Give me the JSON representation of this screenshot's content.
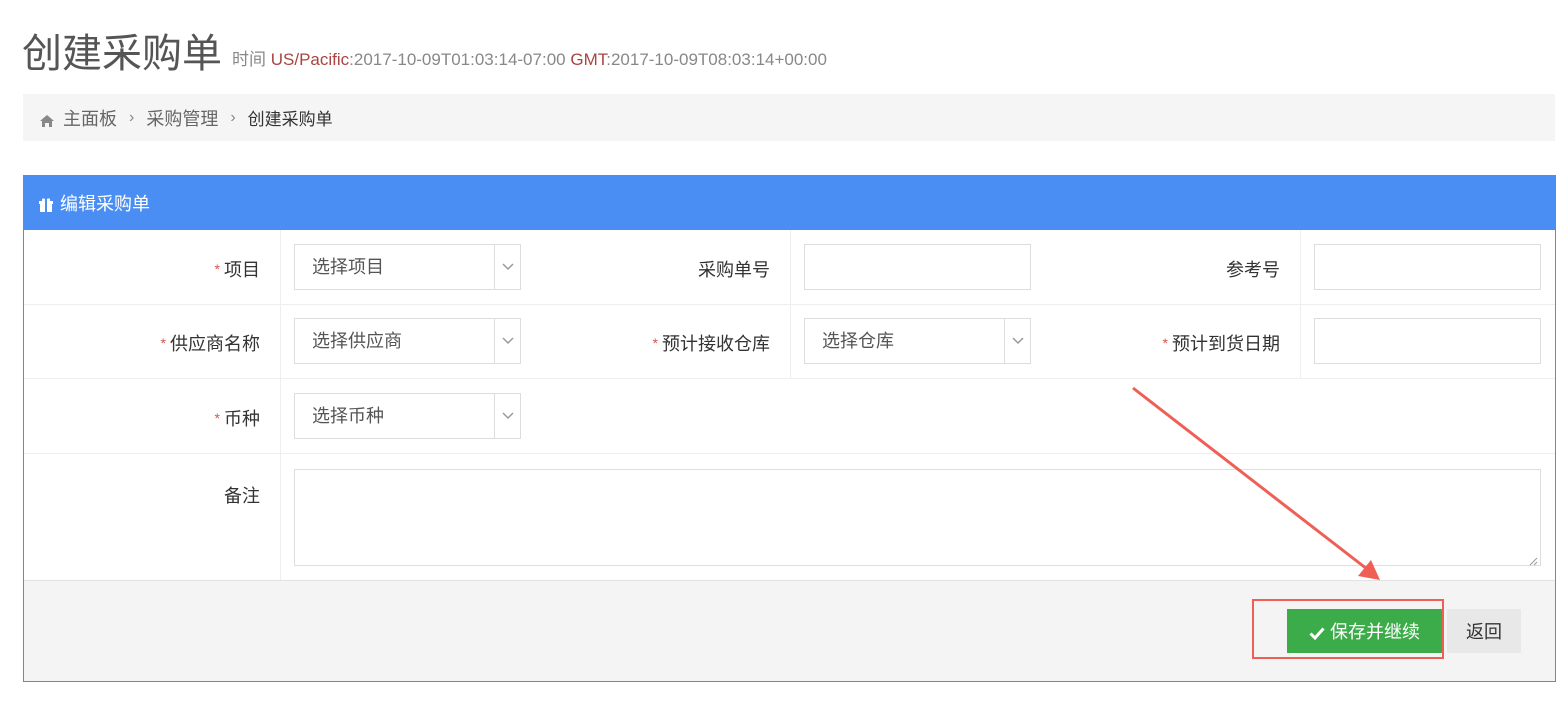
{
  "header": {
    "title": "创建采购单",
    "subtitle_prefix": "时间",
    "tz1_label": "US/Pacific",
    "tz1_value": ":2017-10-09T01:03:14-07:00",
    "tz2_label": "GMT",
    "tz2_value": ":2017-10-09T08:03:14+00:00"
  },
  "breadcrumb": {
    "home_icon": "home-icon",
    "items": [
      "主面板",
      "采购管理",
      "创建采购单"
    ],
    "separator": "›"
  },
  "panel": {
    "heading_icon": "gift-icon",
    "heading": "编辑采购单"
  },
  "form": {
    "required_mark": "*",
    "project_label": "项目",
    "project_placeholder": "选择项目",
    "po_number_label": "采购单号",
    "po_number_value": "",
    "reference_label": "参考号",
    "reference_value": "",
    "supplier_label": "供应商名称",
    "supplier_placeholder": "选择供应商",
    "warehouse_label": "预计接收仓库",
    "warehouse_placeholder": "选择仓库",
    "arrival_date_label": "预计到货日期",
    "arrival_date_value": "",
    "currency_label": "币种",
    "currency_placeholder": "选择币种",
    "notes_label": "备注",
    "notes_value": ""
  },
  "footer": {
    "save_icon": "check-icon",
    "save_label": "保存并继续",
    "back_label": "返回"
  },
  "colors": {
    "primary": "#4a8ef3",
    "success": "#3cab4a",
    "required": "#d9534f",
    "annotation": "#ee6055"
  }
}
